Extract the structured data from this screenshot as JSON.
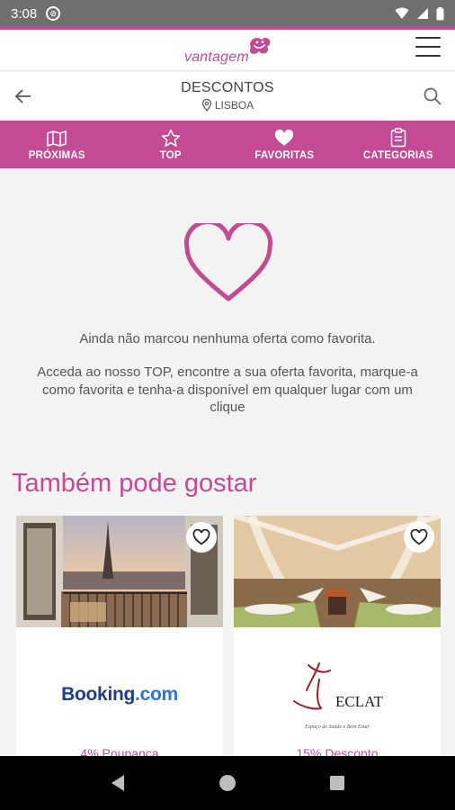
{
  "status_bar": {
    "time": "3:08"
  },
  "app": {
    "logo_text": "vantagem"
  },
  "subheader": {
    "title": "DESCONTOS",
    "location": "LISBOA"
  },
  "tabs": [
    {
      "label": "PRÓXIMAS",
      "icon": "map-icon"
    },
    {
      "label": "TOP",
      "icon": "star-icon"
    },
    {
      "label": "FAVORITAS",
      "icon": "heart-icon",
      "active": true
    },
    {
      "label": "CATEGORIAS",
      "icon": "clipboard-icon"
    }
  ],
  "empty_state": {
    "message": "Ainda não marcou nenhuma oferta como favorita.",
    "hint": "Acceda ao nosso TOP, encontre a sua oferta favorita, marque-a como favorita e tenha-a disponível em qualquer lugar com um clique"
  },
  "recommendations": {
    "title": "Também pode gostar",
    "cards": [
      {
        "brand_a": "Booking",
        "brand_b": ".com",
        "offer": "4% Poupança"
      },
      {
        "brand": "ECLAT",
        "brand_tagline": "Espaço de Saúde e Bem Estar",
        "offer": "15% Desconto"
      }
    ]
  },
  "colors": {
    "accent": "#c44a93",
    "background": "#f3f3f3",
    "booking_dark": "#1b3f8b",
    "booking_light": "#2a75d8"
  }
}
